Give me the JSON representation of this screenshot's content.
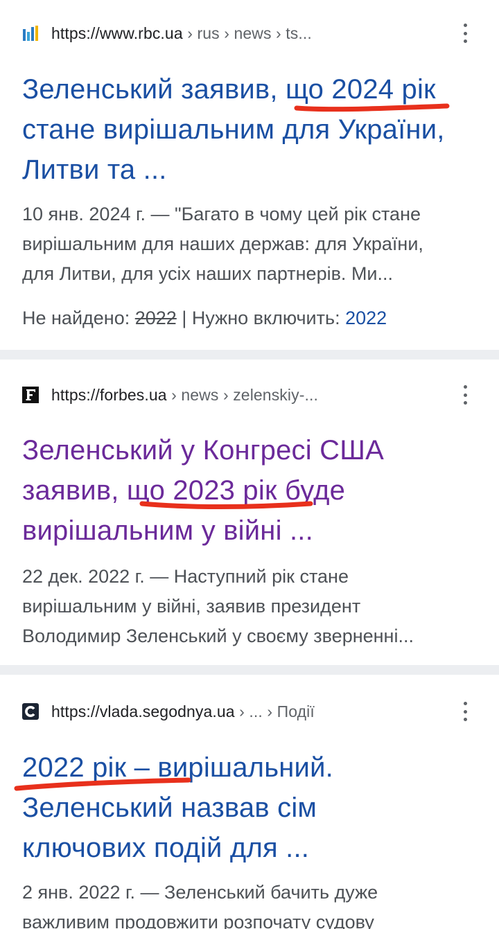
{
  "results": [
    {
      "favicon": "rbc-bars-icon",
      "url_host": "https://www.rbc.ua",
      "url_path": " › rus › news › ts...",
      "title_lines": [
        "Зеленський заявив, що 2024 рік",
        "стане вирішальним для України,",
        "Литви та ..."
      ],
      "snippet_lines": [
        "10 янв. 2024 г. — \"Багато в чому цей рік стане",
        "вирішальним для наших держав: для України,",
        "для Литви, для усіх наших партнерів. Ми..."
      ],
      "missing_label": "Не найдено: ",
      "missing_term": "2022",
      "include_label": " | Нужно включить: ",
      "include_term": "2022",
      "title_color": "#1a4fa3"
    },
    {
      "favicon": "forbes-f-icon",
      "url_host": "https://forbes.ua",
      "url_path": " › news › zelenskiy-...",
      "title_lines": [
        "Зеленський у Конгресі США",
        "заявив, що 2023 рік буде",
        "вирішальним у війні ..."
      ],
      "snippet_lines": [
        "22 дек. 2022 г. — Наступний рік стане",
        "вирішальним у війні, заявив президент",
        "Володимир Зеленський у своєму зверненні..."
      ],
      "title_color": "#6b2a9a"
    },
    {
      "favicon": "segodnya-c-icon",
      "url_host": "https://vlada.segodnya.ua",
      "url_path": " › ... › Події",
      "title_lines": [
        "2022 рік – вирішальний.",
        "Зеленський назвав сім",
        "ключових подій для ..."
      ],
      "snippet_lines": [
        "2 янв. 2022 г. — Зеленський бачить дуже",
        "важливим продовжити розпочату судову"
      ],
      "title_color": "#1a4fa3"
    }
  ],
  "colors": {
    "annotation": "#e8301c",
    "link": "#1a4fa3",
    "visited": "#6b2a9a",
    "separator": "#eceef1"
  }
}
